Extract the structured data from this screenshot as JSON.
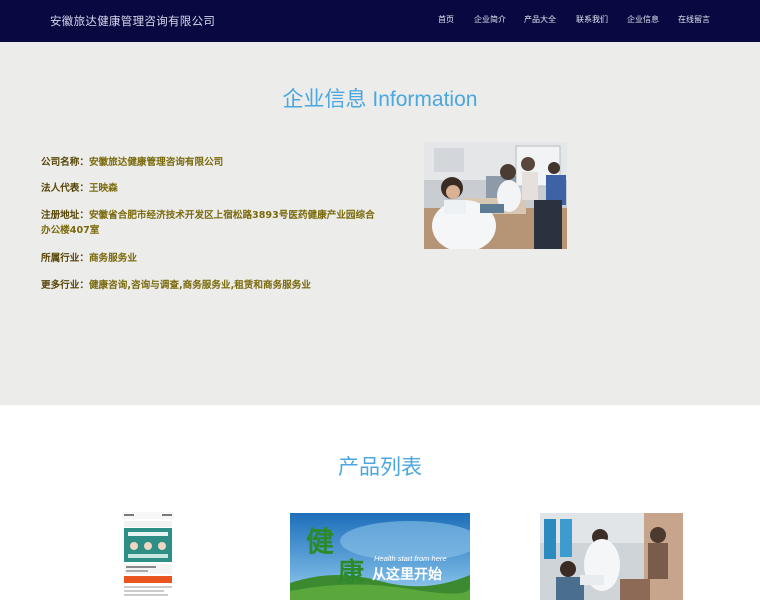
{
  "header": {
    "brand": "安徽旅达健康管理咨询有限公司",
    "nav": [
      "首页",
      "企业简介",
      "产品大全",
      "联系我们",
      "企业信息",
      "在线留言"
    ]
  },
  "company_info": {
    "title": "企业信息 Information",
    "fields": [
      {
        "label": "公司名称：",
        "value": "安徽旅达健康管理咨询有限公司"
      },
      {
        "label": "法人代表：",
        "value": "王映森"
      },
      {
        "label": "注册地址：",
        "value": "安徽省合肥市经济技术开发区上宿松路3893号医药健康产业园综合办公楼407室"
      },
      {
        "label": "所属行业：",
        "value": "商务服务业"
      },
      {
        "label": "更多行业：",
        "value": "健康咨询,咨询与调查,商务服务业,租赁和商务服务业"
      }
    ]
  },
  "products": {
    "title": "产品列表",
    "banner_en": "Health start from here",
    "banner_cn": "从这里开始"
  },
  "colors": {
    "header_bg": "#070940",
    "accent": "#4aa7df",
    "label": "#574507",
    "value": "#7a6a0c"
  }
}
